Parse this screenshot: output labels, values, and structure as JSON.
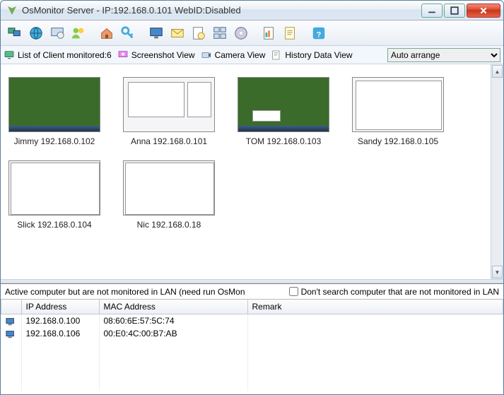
{
  "window": {
    "title": "OsMonitor Server -  IP:192.168.0.101 WebID:Disabled"
  },
  "toolbar_icons": [
    "monitors-icon",
    "globe-icon",
    "screen-config-icon",
    "users-icon",
    "sep",
    "house-icon",
    "key-icon",
    "sep",
    "display-icon",
    "mail-icon",
    "eye-icon",
    "windows-icon",
    "disc-icon",
    "sep",
    "report-icon",
    "report2-icon",
    "sep",
    "help-icon"
  ],
  "viewbar": {
    "client_count_label": "List of Client monitored:6",
    "screenshot_label": "Screenshot View",
    "camera_label": "Camera View",
    "history_label": "History Data View",
    "arrange_selected": "Auto arrange"
  },
  "clients": [
    {
      "name": "Jimmy",
      "ip": "192.168.0.102",
      "bg": "green",
      "wins": []
    },
    {
      "name": "Anna",
      "ip": "192.168.0.101",
      "bg": "white",
      "wins": [
        [
          6,
          6,
          80,
          50
        ],
        [
          90,
          6,
          34,
          50
        ]
      ]
    },
    {
      "name": "TOM",
      "ip": "192.168.0.103",
      "bg": "green",
      "wins": [
        [
          20,
          46,
          40,
          16
        ]
      ]
    },
    {
      "name": "Sandy",
      "ip": "192.168.0.105",
      "bg": "white",
      "wins": [
        [
          4,
          4,
          122,
          70
        ]
      ]
    },
    {
      "name": "Slick",
      "ip": "192.168.0.104",
      "bg": "white",
      "wins": [
        [
          2,
          2,
          126,
          74
        ]
      ]
    },
    {
      "name": "Nic",
      "ip": "192.168.0.18",
      "bg": "white",
      "wins": [
        [
          2,
          2,
          126,
          74
        ]
      ]
    }
  ],
  "bottom": {
    "message": "Active computer but are not monitored in LAN (need run OsMon",
    "checkbox_label": "Don't search computer that are not monitored in LAN",
    "columns": {
      "ip": "IP Address",
      "mac": "MAC Address",
      "remark": "Remark"
    },
    "rows": [
      {
        "ip": "192.168.0.100",
        "mac": "08:60:6E:57:5C:74",
        "remark": ""
      },
      {
        "ip": "192.168.0.106",
        "mac": "00:E0:4C:00:B7:AB",
        "remark": ""
      }
    ]
  }
}
